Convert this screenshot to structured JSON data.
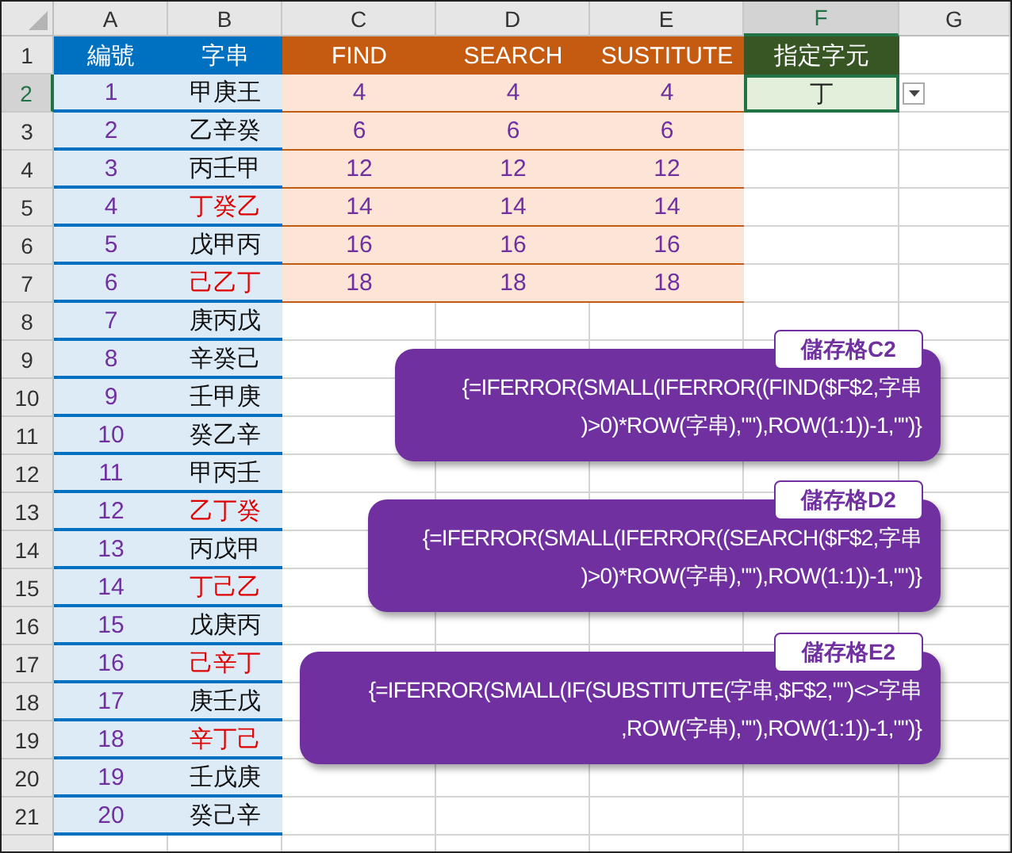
{
  "column_headers": [
    {
      "label": "A",
      "selected": false
    },
    {
      "label": "B",
      "selected": false
    },
    {
      "label": "C",
      "selected": false
    },
    {
      "label": "D",
      "selected": false
    },
    {
      "label": "E",
      "selected": false
    },
    {
      "label": "F",
      "selected": true
    },
    {
      "label": "G",
      "selected": false
    }
  ],
  "row_headers": [
    {
      "label": "1",
      "selected": false
    },
    {
      "label": "2",
      "selected": true
    },
    {
      "label": "3",
      "selected": false
    },
    {
      "label": "4",
      "selected": false
    },
    {
      "label": "5",
      "selected": false
    },
    {
      "label": "6",
      "selected": false
    },
    {
      "label": "7",
      "selected": false
    },
    {
      "label": "8",
      "selected": false
    },
    {
      "label": "9",
      "selected": false
    },
    {
      "label": "10",
      "selected": false
    },
    {
      "label": "11",
      "selected": false
    },
    {
      "label": "12",
      "selected": false
    },
    {
      "label": "13",
      "selected": false
    },
    {
      "label": "14",
      "selected": false
    },
    {
      "label": "15",
      "selected": false
    },
    {
      "label": "16",
      "selected": false
    },
    {
      "label": "17",
      "selected": false
    },
    {
      "label": "18",
      "selected": false
    },
    {
      "label": "19",
      "selected": false
    },
    {
      "label": "20",
      "selected": false
    },
    {
      "label": "21",
      "selected": false
    }
  ],
  "header_row": [
    {
      "text": "編號",
      "color": "#0070c0"
    },
    {
      "text": "字串",
      "color": "#0070c0"
    },
    {
      "text": "FIND",
      "color": "#c55a11"
    },
    {
      "text": "SEARCH",
      "color": "#c55a11"
    },
    {
      "text": "SUSTITUTE",
      "color": "#c55a11"
    },
    {
      "text": "指定字元",
      "color": "#375623"
    }
  ],
  "rows": [
    {
      "no": "1",
      "string": "甲庚王",
      "matched": false,
      "results": [
        "4",
        "4",
        "4"
      ]
    },
    {
      "no": "2",
      "string": "乙辛癸",
      "matched": false,
      "results": [
        "6",
        "6",
        "6"
      ]
    },
    {
      "no": "3",
      "string": "丙壬甲",
      "matched": false,
      "results": [
        "12",
        "12",
        "12"
      ]
    },
    {
      "no": "4",
      "string": "丁癸乙",
      "matched": true,
      "results": [
        "14",
        "14",
        "14"
      ]
    },
    {
      "no": "5",
      "string": "戊甲丙",
      "matched": false,
      "results": [
        "16",
        "16",
        "16"
      ]
    },
    {
      "no": "6",
      "string": "己乙丁",
      "matched": true,
      "results": [
        "18",
        "18",
        "18"
      ]
    },
    {
      "no": "7",
      "string": "庚丙戊",
      "matched": false
    },
    {
      "no": "8",
      "string": "辛癸己",
      "matched": false
    },
    {
      "no": "9",
      "string": "壬甲庚",
      "matched": false
    },
    {
      "no": "10",
      "string": "癸乙辛",
      "matched": false
    },
    {
      "no": "11",
      "string": "甲丙壬",
      "matched": false
    },
    {
      "no": "12",
      "string": "乙丁癸",
      "matched": true
    },
    {
      "no": "13",
      "string": "丙戊甲",
      "matched": false
    },
    {
      "no": "14",
      "string": "丁己乙",
      "matched": true
    },
    {
      "no": "15",
      "string": "戊庚丙",
      "matched": false
    },
    {
      "no": "16",
      "string": "己辛丁",
      "matched": true
    },
    {
      "no": "17",
      "string": "庚壬戊",
      "matched": false
    },
    {
      "no": "18",
      "string": "辛丁己",
      "matched": true
    },
    {
      "no": "19",
      "string": "壬戊庚",
      "matched": false
    },
    {
      "no": "20",
      "string": "癸己辛",
      "matched": false
    }
  ],
  "target_cell": {
    "value": "丁",
    "selected": true
  },
  "callouts": [
    {
      "label": "儲存格C2",
      "formula_lines": [
        "{=IFERROR(SMALL(IFERROR((FIND($F$2,字串",
        ")>0)*ROW(字串),\"\"),ROW(1:1))-1,\"\")}"
      ]
    },
    {
      "label": "儲存格D2",
      "formula_lines": [
        "{=IFERROR(SMALL(IFERROR((SEARCH($F$2,字串",
        ")>0)*ROW(字串),\"\"),ROW(1:1))-1,\"\")}"
      ]
    },
    {
      "label": "儲存格E2",
      "formula_lines": [
        "{=IFERROR(SMALL(IF(SUBSTITUTE(字串,$F$2,\"\")<>字串",
        ",ROW(字串),\"\"),ROW(1:1))-1,\"\")}"
      ]
    }
  ]
}
